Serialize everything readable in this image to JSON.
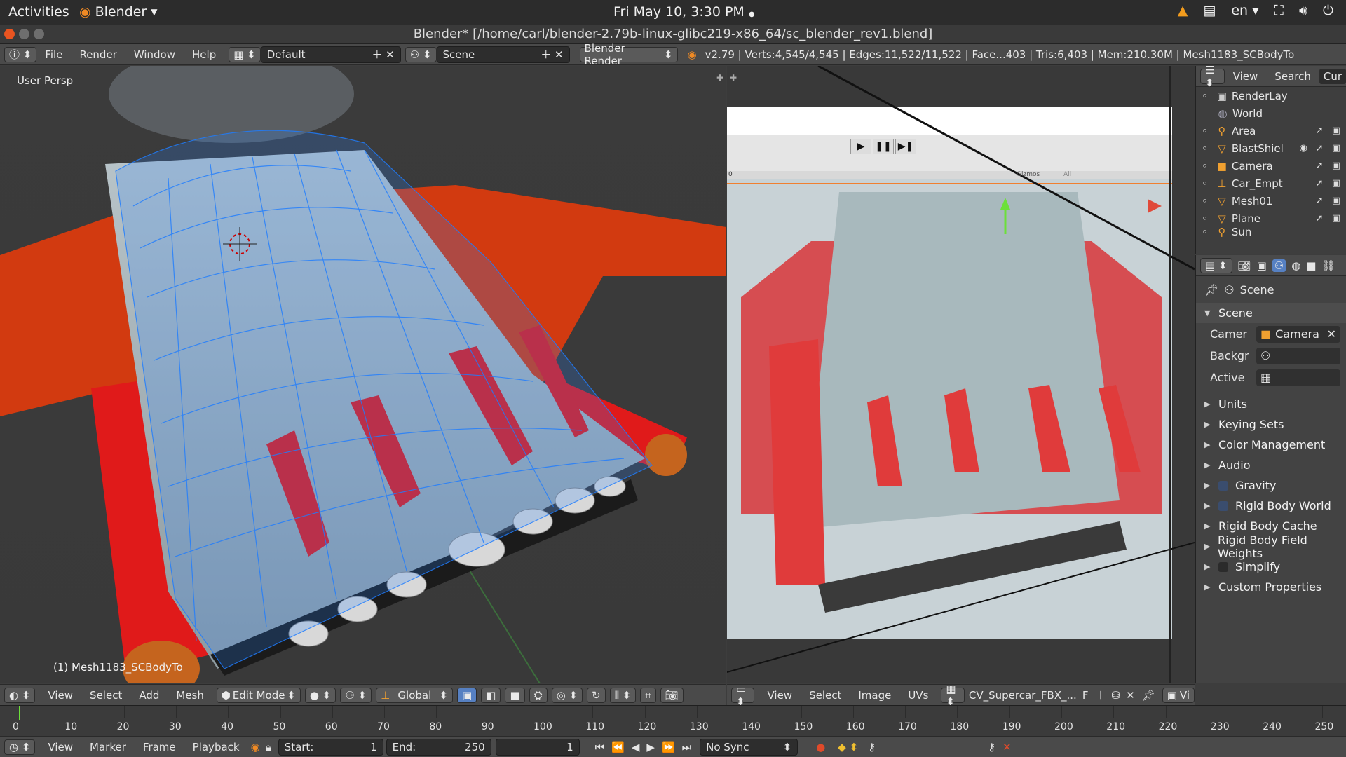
{
  "topbar": {
    "activities": "Activities",
    "app_name": "Blender",
    "clock": "Fri May 10,  3:30 PM",
    "lang": "en"
  },
  "window": {
    "title": "Blender* [/home/carl/blender-2.79b-linux-glibc219-x86_64/sc_blender_rev1.blend]"
  },
  "info": {
    "menus": [
      "File",
      "Render",
      "Window",
      "Help"
    ],
    "layout": "Default",
    "scene": "Scene",
    "engine": "Blender Render",
    "stats": "v2.79 | Verts:4,545/4,545 | Edges:11,522/11,522 | Face...403 | Tris:6,403 | Mem:210.30M | Mesh1183_SCBodyTo"
  },
  "viewport": {
    "view_label": "User Persp",
    "object_label": "(1) Mesh1183_SCBodyTo",
    "header_menus": [
      "View",
      "Select",
      "Add",
      "Mesh"
    ],
    "mode": "Edit Mode",
    "orientation": "Global"
  },
  "image_editor": {
    "header_menus": [
      "View",
      "Select",
      "Image",
      "UVs"
    ],
    "image_name": "CV_Supercar_FBX_...",
    "extra": "F",
    "view_btn": "Vi",
    "gizmos": "Gizmos",
    "all": "All",
    "zero": "0"
  },
  "outliner": {
    "menus": [
      "View",
      "Search",
      "Cur"
    ],
    "rows": [
      {
        "label": "RenderLay",
        "icon": "renderlayer-icon"
      },
      {
        "label": "World",
        "icon": "world-icon"
      },
      {
        "label": "Area",
        "icon": "lamp-icon"
      },
      {
        "label": "BlastShiel",
        "icon": "mesh-icon"
      },
      {
        "label": "Camera",
        "icon": "camera-icon"
      },
      {
        "label": "Car_Empt",
        "icon": "empty-icon"
      },
      {
        "label": "Mesh01",
        "icon": "mesh-icon"
      },
      {
        "label": "Plane",
        "icon": "mesh-icon"
      },
      {
        "label": "Sun",
        "icon": "lamp-icon"
      }
    ]
  },
  "properties": {
    "breadcrumb": "Scene",
    "scene_panel": "Scene",
    "camera_label": "Camer",
    "camera_value": "Camera",
    "background_label": "Backgr",
    "active_label": "Active",
    "panels": [
      {
        "label": "Units",
        "checkbox": false
      },
      {
        "label": "Keying Sets",
        "checkbox": false
      },
      {
        "label": "Color Management",
        "checkbox": false
      },
      {
        "label": "Audio",
        "checkbox": false
      },
      {
        "label": "Gravity",
        "checkbox": true
      },
      {
        "label": "Rigid Body World",
        "checkbox": true
      },
      {
        "label": "Rigid Body Cache",
        "checkbox": false
      },
      {
        "label": "Rigid Body Field Weights",
        "checkbox": false
      },
      {
        "label": "Simplify",
        "checkbox": true
      },
      {
        "label": "Custom Properties",
        "checkbox": false
      }
    ]
  },
  "timeline": {
    "ticks": [
      "0",
      "10",
      "20",
      "30",
      "40",
      "50",
      "60",
      "70",
      "80",
      "90",
      "100",
      "110",
      "120",
      "130",
      "140",
      "150",
      "160",
      "170",
      "180",
      "190",
      "200",
      "210",
      "220",
      "230",
      "240",
      "250"
    ],
    "menus": [
      "View",
      "Marker",
      "Frame",
      "Playback"
    ],
    "start_label": "Start:",
    "start_value": "1",
    "end_label": "End:",
    "end_value": "250",
    "current_frame": "1",
    "sync": "No Sync"
  }
}
